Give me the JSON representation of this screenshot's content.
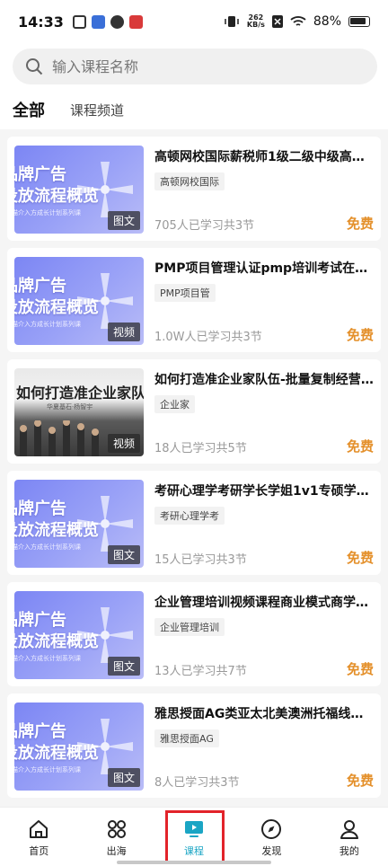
{
  "status_bar": {
    "time": "14:33",
    "net_speed_value": "262",
    "net_speed_unit": "KB/s",
    "battery": "88%"
  },
  "search": {
    "placeholder": "输入课程名称"
  },
  "tabs": [
    {
      "label": "全部",
      "active": true
    },
    {
      "label": "课程频道",
      "active": false
    }
  ],
  "thumbnail_text": {
    "ad_line1": "品牌广告",
    "ad_line2": "投放流程概览",
    "ad_sub": "赛猫介入方成长计划系列课",
    "team_line": "如何打造准企业家队伍",
    "team_sub": "华夏基石·杨智宇"
  },
  "courses": [
    {
      "title": "高顿网校国际薪税师1级二级中级高级C…",
      "tag": "高顿网校国际",
      "learners": "705人已学习共3节",
      "price": "免费",
      "badge": "图文",
      "thumb": "ad"
    },
    {
      "title": "PMP项目管理认证pmp培训考试在线远…",
      "tag": "PMP项目管",
      "learners": "1.0W人已学习共3节",
      "price": "免费",
      "badge": "视频",
      "thumb": "ad"
    },
    {
      "title": "如何打造准企业家队伍-批量复制经营者…",
      "tag": "企业家",
      "learners": "18人已学习共5节",
      "price": "免费",
      "badge": "视频",
      "thumb": "team"
    },
    {
      "title": "考研心理学考研学长学姐1v1专硕学硕…",
      "tag": "考研心理学考",
      "learners": "15人已学习共3节",
      "price": "免费",
      "badge": "图文",
      "thumb": "ad"
    },
    {
      "title": "企业管理培训视频课程商业模式商学院…",
      "tag": "企业管理培训",
      "learners": "13人已学习共7节",
      "price": "免费",
      "badge": "图文",
      "thumb": "ad"
    },
    {
      "title": "雅思授面AG类亚太北美澳洲托福线下雅…",
      "tag": "雅思授面AG",
      "learners": "8人已学习共3节",
      "price": "免费",
      "badge": "图文",
      "thumb": "ad"
    }
  ],
  "bottom_nav": [
    {
      "label": "首页",
      "icon": "home-icon"
    },
    {
      "label": "出海",
      "icon": "apps-icon"
    },
    {
      "label": "课程",
      "icon": "course-icon",
      "active": true
    },
    {
      "label": "发现",
      "icon": "compass-icon"
    },
    {
      "label": "我的",
      "icon": "person-icon"
    }
  ],
  "colors": {
    "accent": "#1aa5c4",
    "price": "#e4902b",
    "highlight": "#e2232a",
    "thumb": "#7c86f4"
  }
}
